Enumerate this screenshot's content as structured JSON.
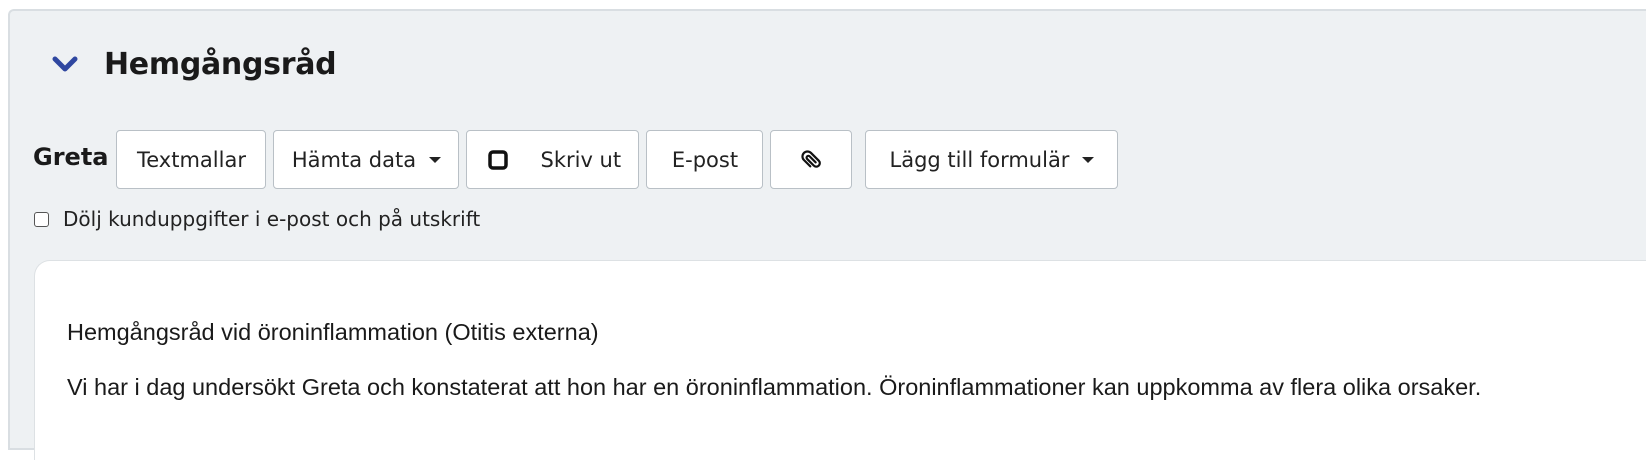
{
  "section": {
    "title": "Hemgångsråd",
    "collapse_icon": "chevron-down-icon",
    "icon_color": "#2f47a0"
  },
  "toolbar": {
    "name": "Greta",
    "buttons": {
      "templates": "Textmallar",
      "fetch_data": "Hämta data",
      "print": "Skriv ut",
      "email": "E-post",
      "attach_icon": "paperclip-icon",
      "add_form": "Lägg till formulär"
    }
  },
  "options": {
    "hide_customer_label": "Dölj kunduppgifter i e-post och på utskrift",
    "hide_customer_checked": false
  },
  "editor": {
    "heading": "Hemgångsråd vid öroninflammation (Otitis externa)",
    "paragraph": "Vi har i dag undersökt Greta och konstaterat att hon har en öroninflammation. Öroninflammationer kan uppkomma av flera olika orsaker."
  }
}
